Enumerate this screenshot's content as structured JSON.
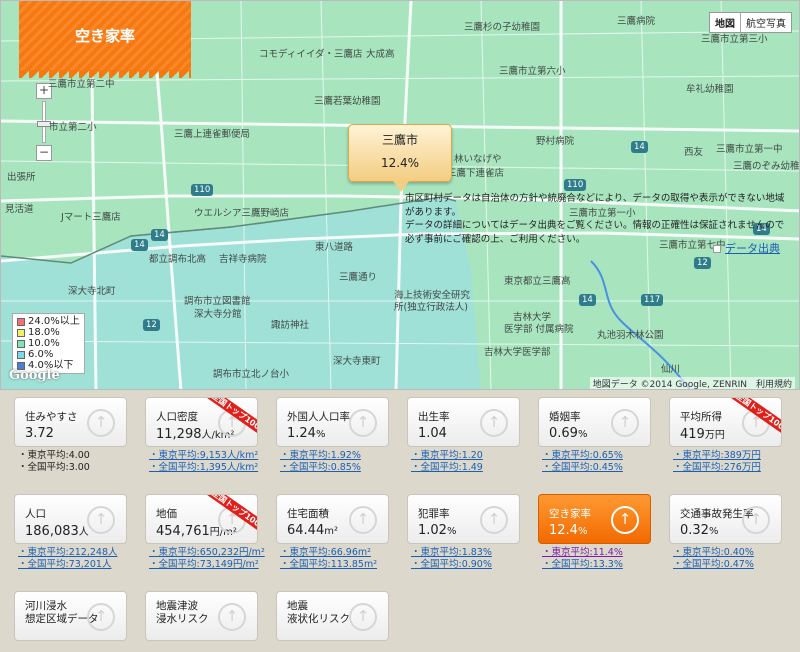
{
  "map": {
    "title": "空き家率",
    "maptype": {
      "map": "地図",
      "satellite": "航空写真"
    },
    "zoom": {
      "plus": "+",
      "minus": "−"
    },
    "callout": {
      "name": "三鷹市",
      "value": "12.4%"
    },
    "legend": [
      "24.0%以上",
      "18.0%",
      "10.0%",
      "6.0%",
      "4.0%以下"
    ],
    "legend_colors": [
      "#f56d75",
      "#f0f06a",
      "#7ee8b4",
      "#7fd6e6",
      "#4a7fd6"
    ],
    "google": "Google",
    "credit": "地図データ ©2014 Google, ZENRIN　利用規約",
    "labels": [
      "三鷹市立第二中",
      "市立第二小",
      "出張所",
      "見活道",
      "Jマート三鷹店",
      "三鷹上連雀郵便局",
      "ウエルシア三鷹野崎店",
      "コモディイイダ・三鷹店",
      "大成高",
      "三鷹若葉幼稚園",
      "三鷹市立第六小",
      "三鷹杉の子幼稚園",
      "三鷹病院",
      "三鷹市立第三小",
      "牟礼幼稚園",
      "野村病院",
      "林いなげや",
      "三鷹下連雀店",
      "三鷹市立第一小",
      "西友",
      "三鷹市立第一中",
      "三鷹のぞみ幼稚",
      "三鷹市立第七中",
      "東八道路",
      "都立調布北高",
      "吉祥寺病院",
      "深大寺北町",
      "調布市立図書館",
      "深大寺分館",
      "諏訪神社",
      "調布市立北ノ台小",
      "三鷹通り",
      "深大寺東町",
      "海上技術安全研究",
      "所(独立行政法人)",
      "東京都立三鷹高",
      "吉林大学",
      "医学部 付属病院",
      "丸池羽木林公園",
      "吉林大学医学部",
      "仙川"
    ]
  },
  "cells": [
    {
      "label": "住みやすさ",
      "value": "3.72",
      "unit": "",
      "ribbon": "",
      "tokyo": "・東京平均:4.00",
      "zenkoku": "・全国平均:3.00",
      "link": false
    },
    {
      "label": "人口密度",
      "value": "11,298",
      "unit": "人/km²",
      "ribbon": "全国トップ100",
      "tokyo": "・東京平均:9,153人/km²",
      "zenkoku": "・全国平均:1,395人/km²",
      "link": true
    },
    {
      "label": "外国人人口率",
      "value": "1.24",
      "unit": "%",
      "ribbon": "",
      "tokyo": "・東京平均:1.92%",
      "zenkoku": "・全国平均:0.85%",
      "link": true
    },
    {
      "label": "出生率",
      "value": "1.04",
      "unit": "",
      "ribbon": "",
      "tokyo": "・東京平均:1.20",
      "zenkoku": "・全国平均:1.49",
      "link": true
    },
    {
      "label": "婚姻率",
      "value": "0.69",
      "unit": "%",
      "ribbon": "",
      "tokyo": "・東京平均:0.65%",
      "zenkoku": "・全国平均:0.45%",
      "link": true
    },
    {
      "label": "平均所得",
      "value": "419",
      "unit": "万円",
      "ribbon": "全国トップ100",
      "tokyo": "・東京平均:389万円",
      "zenkoku": "・全国平均:276万円",
      "link": true
    },
    {
      "label": "人口",
      "value": "186,083",
      "unit": "人",
      "ribbon": "",
      "tokyo": "・東京平均:212,248人",
      "zenkoku": "・全国平均:73,201人",
      "link": true
    },
    {
      "label": "地価",
      "value": "454,761",
      "unit": "円/m²",
      "ribbon": "全国トップ100",
      "tokyo": "・東京平均:650,232円/m²",
      "zenkoku": "・全国平均:73,149円/m²",
      "link": true
    },
    {
      "label": "住宅面積",
      "value": "64.44",
      "unit": "m²",
      "ribbon": "",
      "tokyo": "・東京平均:66.96m²",
      "zenkoku": "・全国平均:113.85m²",
      "link": true
    },
    {
      "label": "犯罪率",
      "value": "1.02",
      "unit": "%",
      "ribbon": "",
      "tokyo": "・東京平均:1.83%",
      "zenkoku": "・全国平均:0.90%",
      "link": true
    },
    {
      "label": "空き家率",
      "value": "12.4",
      "unit": "%",
      "ribbon": "",
      "tokyo": "・東京平均:11.4%",
      "zenkoku": "・全国平均:13.3%",
      "link": true,
      "active": true
    },
    {
      "label": "交通事故発生率",
      "value": "0.32",
      "unit": "%",
      "ribbon": "",
      "tokyo": "・東京平均:0.40%",
      "zenkoku": "・全国平均:0.47%",
      "link": true
    },
    {
      "label": "河川浸水\n想定区域データ",
      "value": "",
      "unit": "",
      "ribbon": "",
      "tokyo": "",
      "zenkoku": "",
      "link": false
    },
    {
      "label": "地震津波\n浸水リスク",
      "value": "",
      "unit": "",
      "ribbon": "",
      "tokyo": "",
      "zenkoku": "",
      "link": false
    },
    {
      "label": "地震\n液状化リスク",
      "value": "",
      "unit": "",
      "ribbon": "",
      "tokyo": "",
      "zenkoku": "",
      "link": false
    }
  ],
  "note": "市区町村データは自治体の方針や統廃合などにより、データの取得や表示ができない地域があります。\nデータの詳細についてはデータ出典をご覧ください。情報の正確性は保証されませんので必ず事前にご確認の上、ご利用ください。",
  "source": "データ出典"
}
